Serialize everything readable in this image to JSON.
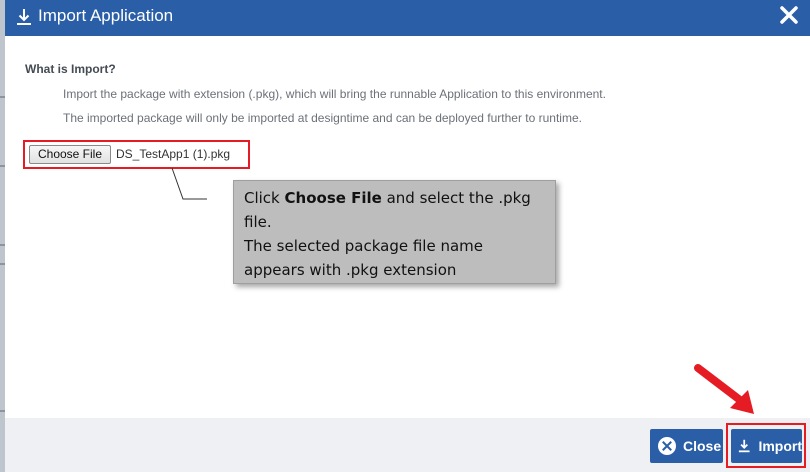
{
  "header": {
    "title": "Import Application",
    "bg_color": "#2a5fa8"
  },
  "content": {
    "heading": "What is Import?",
    "description_1": "Import the package with extension (.pkg), which will bring the runnable Application to this environment.",
    "description_2": "The imported package will only be imported at designtime and can be deployed further to runtime."
  },
  "file_input": {
    "button_label": "Choose File",
    "selected_file": "DS_TestApp1 (1).pkg"
  },
  "callout": {
    "line1_prefix": "Click ",
    "line1_bold": "Choose File",
    "line1_suffix": " and select the .pkg file.",
    "line2": "The selected package file name appears with .pkg extension"
  },
  "footer": {
    "close_label": "Close",
    "import_label": "Import"
  },
  "colors": {
    "primary": "#2a5fa8",
    "highlight": "#e51c23",
    "callout_bg": "#bdbdbd"
  },
  "icons": {
    "header": "download-icon",
    "close": "close-icon",
    "close_button": "close-circle-icon",
    "import_button": "download-icon"
  }
}
